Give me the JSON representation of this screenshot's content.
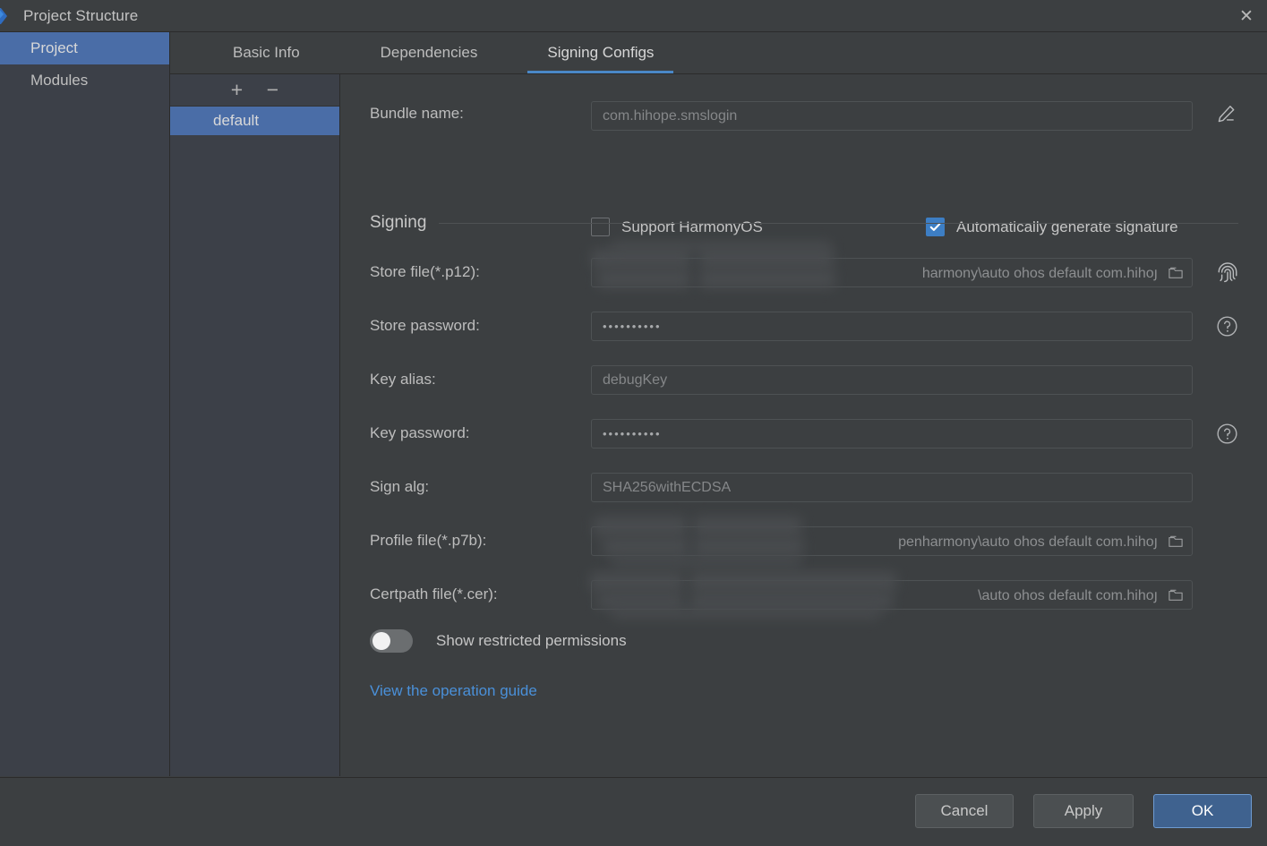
{
  "window": {
    "title": "Project Structure",
    "app_icon": "deveco-logo-icon",
    "close_label": "✕"
  },
  "sidebar": {
    "items": [
      {
        "label": "Project",
        "selected": true
      },
      {
        "label": "Modules",
        "selected": false
      }
    ]
  },
  "tabs": [
    {
      "label": "Basic Info",
      "active": false
    },
    {
      "label": "Dependencies",
      "active": false
    },
    {
      "label": "Signing Configs",
      "active": true
    }
  ],
  "config_list": {
    "add_label": "+",
    "remove_label": "−",
    "items": [
      {
        "label": "default",
        "selected": true
      }
    ]
  },
  "form": {
    "bundle_name": {
      "label": "Bundle name:",
      "value": "com.hihope.smslogin"
    },
    "support_harmonyos": {
      "label": "Support HarmonyOS",
      "checked": false
    },
    "auto_generate_signature": {
      "label": "Automatically generate signature",
      "checked": true
    },
    "section_title": "Signing",
    "store_file": {
      "label": "Store file(*.p12):",
      "value": "harmony\\auto ohos default com.hihoյ"
    },
    "store_password": {
      "label": "Store password:",
      "value": "••••••••••"
    },
    "key_alias": {
      "label": "Key alias:",
      "value": "debugKey"
    },
    "key_password": {
      "label": "Key password:",
      "value": "••••••••••"
    },
    "sign_alg": {
      "label": "Sign alg:",
      "value": "SHA256withECDSA"
    },
    "profile_file": {
      "label": "Profile file(*.p7b):",
      "value": "penharmony\\auto ohos default com.hihoյ"
    },
    "certpath_file": {
      "label": "Certpath file(*.cer):",
      "value": "\\auto ohos default com.hihoյ"
    },
    "show_restricted_permissions": {
      "label": "Show restricted permissions",
      "on": false
    },
    "operation_guide_link": "View the operation guide"
  },
  "icons": {
    "edit": "pencil-icon",
    "fingerprint": "fingerprint-icon",
    "help": "help-icon",
    "browse": "folder-icon"
  },
  "footer": {
    "cancel": "Cancel",
    "apply": "Apply",
    "ok": "OK"
  },
  "colors": {
    "accent_blue": "#4a88c7",
    "selection_blue": "#4a6da7",
    "checkbox_blue": "#3d7ec4",
    "link_blue": "#4a90d9",
    "primary_button": "#3f628f",
    "panel_bg": "#3c3f41",
    "nav_bg": "#3c4048"
  }
}
